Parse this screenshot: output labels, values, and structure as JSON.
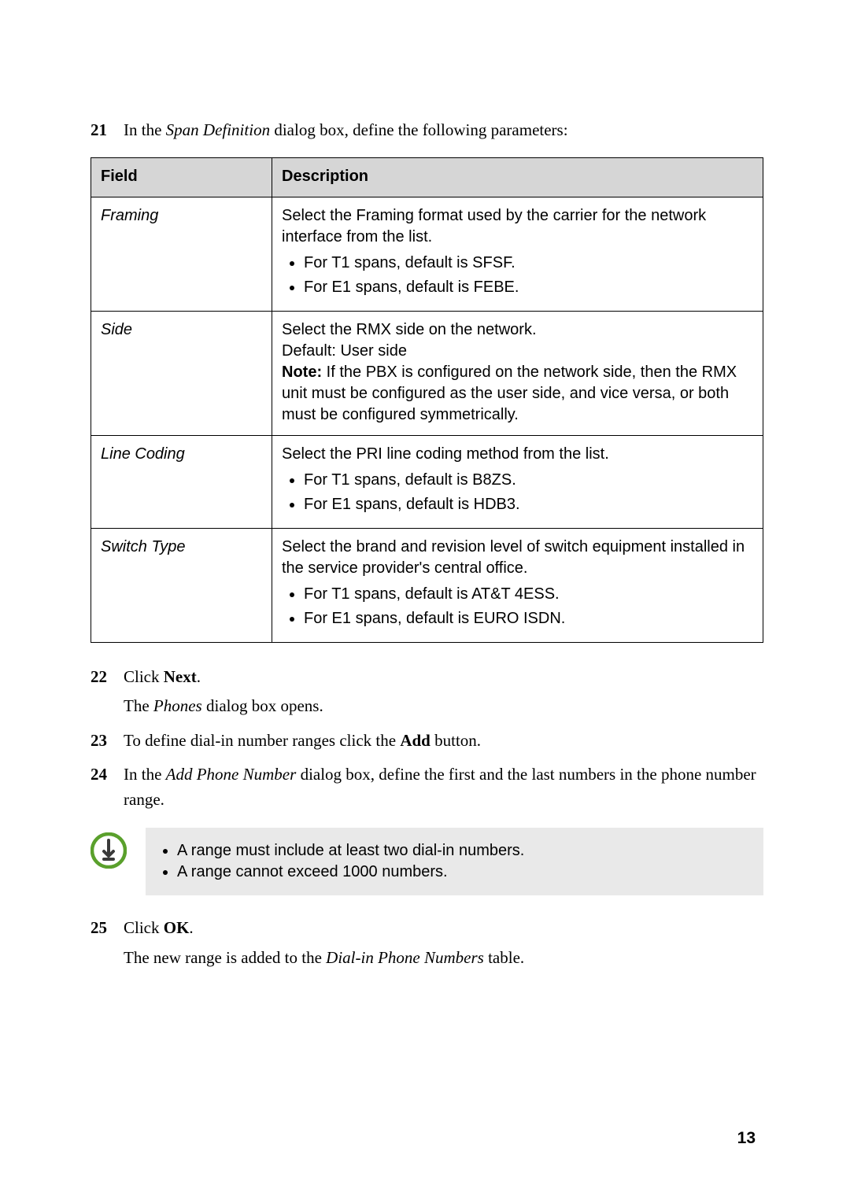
{
  "step21": {
    "num": "21",
    "pre": "In the ",
    "ital": "Span Definition",
    "post": " dialog box, define the following parameters:"
  },
  "table": {
    "headers": {
      "field": "Field",
      "desc": "Description"
    },
    "rows": [
      {
        "field": "Framing",
        "desc_top": "Select the Framing format used by the carrier for the network interface from the list.",
        "bullets": [
          "For T1 spans, default is SFSF.",
          "For E1 spans, default is FEBE."
        ]
      },
      {
        "field": "Side",
        "desc_top": "Select the RMX side on the network.",
        "desc_line2": "Default: User side",
        "note_label": "Note:",
        "note_text": " If the PBX is configured on the network side, then the RMX unit must be configured as the user side, and vice versa, or both must be configured symmetrically."
      },
      {
        "field": "Line Coding",
        "desc_top": "Select the PRI line coding method from the list.",
        "bullets": [
          "For T1 spans, default is B8ZS.",
          "For E1 spans, default is HDB3."
        ]
      },
      {
        "field": "Switch Type",
        "desc_top": "Select the brand and revision level of switch equipment installed in the service provider's central office.",
        "bullets": [
          "For T1 spans, default is AT&T 4ESS.",
          "For E1 spans, default is EURO ISDN."
        ]
      }
    ]
  },
  "step22": {
    "num": "22",
    "pre": "Click ",
    "bold": "Next",
    "post": ".",
    "sub_pre": "The ",
    "sub_ital": "Phones",
    "sub_post": " dialog box opens."
  },
  "step23": {
    "num": "23",
    "pre": "To define dial-in number ranges click the ",
    "bold": "Add",
    "post": " button."
  },
  "step24": {
    "num": "24",
    "pre": "In the ",
    "ital": "Add Phone Number",
    "post": " dialog box, define the first and the last numbers in the phone number range."
  },
  "noteBullets": [
    "A range must include at least two dial-in numbers.",
    "A range cannot exceed 1000 numbers."
  ],
  "step25": {
    "num": "25",
    "pre": "Click ",
    "bold": "OK",
    "post": ".",
    "sub_pre": "The new range is added to the ",
    "sub_ital": "Dial-in Phone Numbers",
    "sub_post": " table."
  },
  "pageNumber": "13"
}
